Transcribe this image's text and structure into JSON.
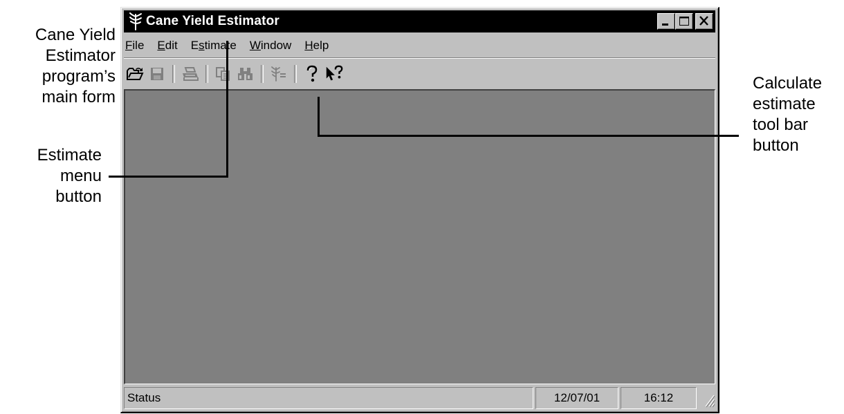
{
  "window": {
    "title": "Cane Yield Estimator"
  },
  "menu": {
    "items": [
      {
        "id": "file",
        "pre": "",
        "mnemonic": "F",
        "post": "ile"
      },
      {
        "id": "edit",
        "pre": "",
        "mnemonic": "E",
        "post": "dit"
      },
      {
        "id": "estimate",
        "pre": "E",
        "mnemonic": "s",
        "post": "timate"
      },
      {
        "id": "window",
        "pre": "",
        "mnemonic": "W",
        "post": "indow"
      },
      {
        "id": "help",
        "pre": "",
        "mnemonic": "H",
        "post": "elp"
      }
    ]
  },
  "toolbar": {
    "icons": [
      "open-folder-icon",
      "save-disk-icon",
      "print-icon",
      "copy-icon",
      "find-binoculars-icon",
      "calculate-estimate-icon",
      "help-icon",
      "context-help-icon"
    ]
  },
  "statusbar": {
    "status": "Status",
    "date": "12/07/01",
    "time": "16:12"
  },
  "callouts": {
    "main_form": [
      "Cane Yield",
      "Estimator",
      "program’s",
      "main form"
    ],
    "estimate_menu": [
      "Estimate",
      "menu",
      "button"
    ],
    "calculate_button": [
      "Calculate",
      "estimate",
      "tool bar",
      "button"
    ]
  },
  "colors": {
    "titlebar": "#000000",
    "window_face": "#c0c0c0",
    "client_area": "#808080"
  }
}
